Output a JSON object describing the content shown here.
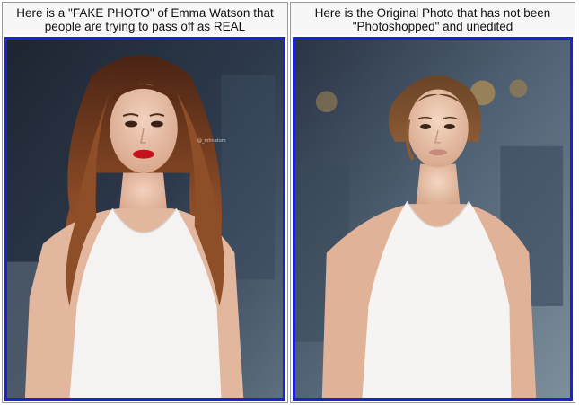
{
  "left_panel": {
    "caption_line1": "Here is a \"FAKE PHOTO\" of Emma Watson that",
    "caption_line2": "people are trying to pass off as REAL",
    "image_watermark": "@_mhnatom"
  },
  "right_panel": {
    "caption_line1": "Here is the Original Photo that has not been",
    "caption_line2": "\"Photoshopped\" and unedited"
  },
  "colors": {
    "frame_border": "#1a22d6",
    "panel_border": "#9a9a9a",
    "caption_text": "#111111"
  }
}
